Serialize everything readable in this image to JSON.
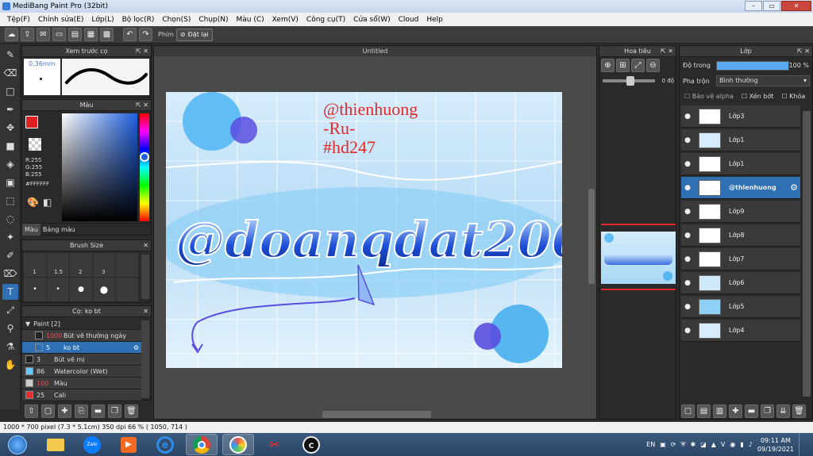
{
  "window": {
    "title": "MediBang Paint Pro (32bit)",
    "min": "–",
    "max": "▭",
    "close": "✕"
  },
  "menu": [
    "Tệp(F)",
    "Chỉnh sửa(E)",
    "Lớp(L)",
    "Bộ lọc(R)",
    "Chọn(S)",
    "Chụp(N)",
    "Màu (C)",
    "Xem(V)",
    "Công cụ(T)",
    "Cửa sổ(W)",
    "Cloud",
    "Help"
  ],
  "toolbar": {
    "phim_label": "Phím",
    "reset_label": "Đặt lại"
  },
  "brush_preview": {
    "title": "Xem trước cọ",
    "size": "0.36mm"
  },
  "color_panel": {
    "title": "Màu",
    "r": "R:255",
    "g": "G:255",
    "b": "B:255",
    "hex": "#FFFFFF",
    "tab_color": "Màu",
    "tab_palette": "Bảng màu"
  },
  "brush_size": {
    "title": "Brush Size",
    "sizes": [
      "1",
      "1.5",
      "2",
      "3"
    ]
  },
  "brush_panel": {
    "title": "Cọ: ko bt",
    "group": "Paint [2]",
    "items": [
      {
        "num": "1000",
        "name": "Bút vẽ thường ngày",
        "color": "#222222",
        "numcolor": "#e05050"
      },
      {
        "num": "5",
        "name": "ko bt",
        "color": "#2f6fb3",
        "numcolor": "#ffffff"
      },
      {
        "num": "3",
        "name": "Bút vẽ mị",
        "color": "#222222",
        "numcolor": "#dddddd"
      },
      {
        "num": "86",
        "name": "Watercolor (Wet)",
        "color": "#66c8ff",
        "numcolor": "#dddddd"
      },
      {
        "num": "100",
        "name": "Màu",
        "color": "#cccccc",
        "numcolor": "#e05050"
      },
      {
        "num": "25",
        "name": "Cali",
        "color": "#e03030",
        "numcolor": "#dddddd"
      }
    ]
  },
  "canvas": {
    "title": "Untitled",
    "text_lines": [
      "@thienhuong",
      "-Ru-",
      "#hd247"
    ],
    "big_text": "@doanqdat2005"
  },
  "navigator": {
    "title": "Hoa tiêu",
    "angle": "0 độ"
  },
  "layer_panel": {
    "title": "Lớp",
    "opacity_label": "Độ trong",
    "opacity_value": "100 %",
    "opacity_fraction": 1.0,
    "blend_label": "Pha trộn",
    "blend_value": "Bình thường",
    "protect_alpha": "Bảo vệ alpha",
    "clip": "Xén bớt",
    "lock": "Khóa",
    "layers": [
      "Lớp3",
      "Lớp1",
      "Lớp1",
      "@thienhuong",
      "Lớp9",
      "Lớp8",
      "Lớp7",
      "Lớp6",
      "Lớp5",
      "Lớp4"
    ]
  },
  "status": {
    "text": "1000 * 700 pixel  (7.3 * 5.1cm)  350 dpi  66 %  ( 1050, 714 )"
  },
  "taskbar": {
    "lang": "EN",
    "time": "09:11 AM",
    "date": "09/19/2021",
    "zalo": "Zalo"
  }
}
